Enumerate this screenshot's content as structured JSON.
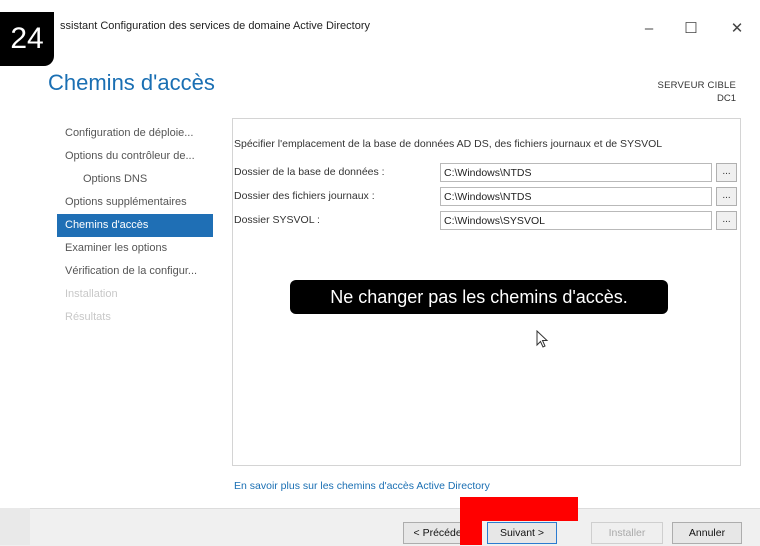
{
  "window": {
    "title": "ssistant Configuration des services de domaine Active Directory",
    "minimize": "–",
    "maximize": "☐",
    "close": "✕"
  },
  "step_badge": "24",
  "page": {
    "title": "Chemins d'accès",
    "server_label": "SERVEUR CIBLE",
    "server_name": "DC1"
  },
  "nav": {
    "items": [
      {
        "label": "Configuration de déploie...",
        "state": "normal"
      },
      {
        "label": "Options du contrôleur de...",
        "state": "normal"
      },
      {
        "label": "Options DNS",
        "state": "sub"
      },
      {
        "label": "Options supplémentaires",
        "state": "normal"
      },
      {
        "label": "Chemins d'accès",
        "state": "active"
      },
      {
        "label": "Examiner les options",
        "state": "normal"
      },
      {
        "label": "Vérification de la configur...",
        "state": "normal"
      },
      {
        "label": "Installation",
        "state": "disabled"
      },
      {
        "label": "Résultats",
        "state": "disabled"
      }
    ]
  },
  "content": {
    "description": "Spécifier l'emplacement de la base de données AD DS, des fichiers journaux et de SYSVOL",
    "rows": [
      {
        "label": "Dossier de la base de données :",
        "value": "C:\\Windows\\NTDS",
        "browse": "..."
      },
      {
        "label": "Dossier des fichiers journaux :",
        "value": "C:\\Windows\\NTDS",
        "browse": "..."
      },
      {
        "label": "Dossier SYSVOL :",
        "value": "C:\\Windows\\SYSVOL",
        "browse": "..."
      }
    ],
    "callout": "Ne changer pas les chemins d'accès.",
    "learn_more": "En savoir plus sur les chemins d'accès Active Directory"
  },
  "footer": {
    "previous": "< Précédent",
    "next": "Suivant >",
    "install": "Installer",
    "cancel": "Annuler"
  },
  "colors": {
    "accent": "#1f6fb5",
    "title": "#1a6fb3",
    "highlight_marker": "#ff0000"
  }
}
